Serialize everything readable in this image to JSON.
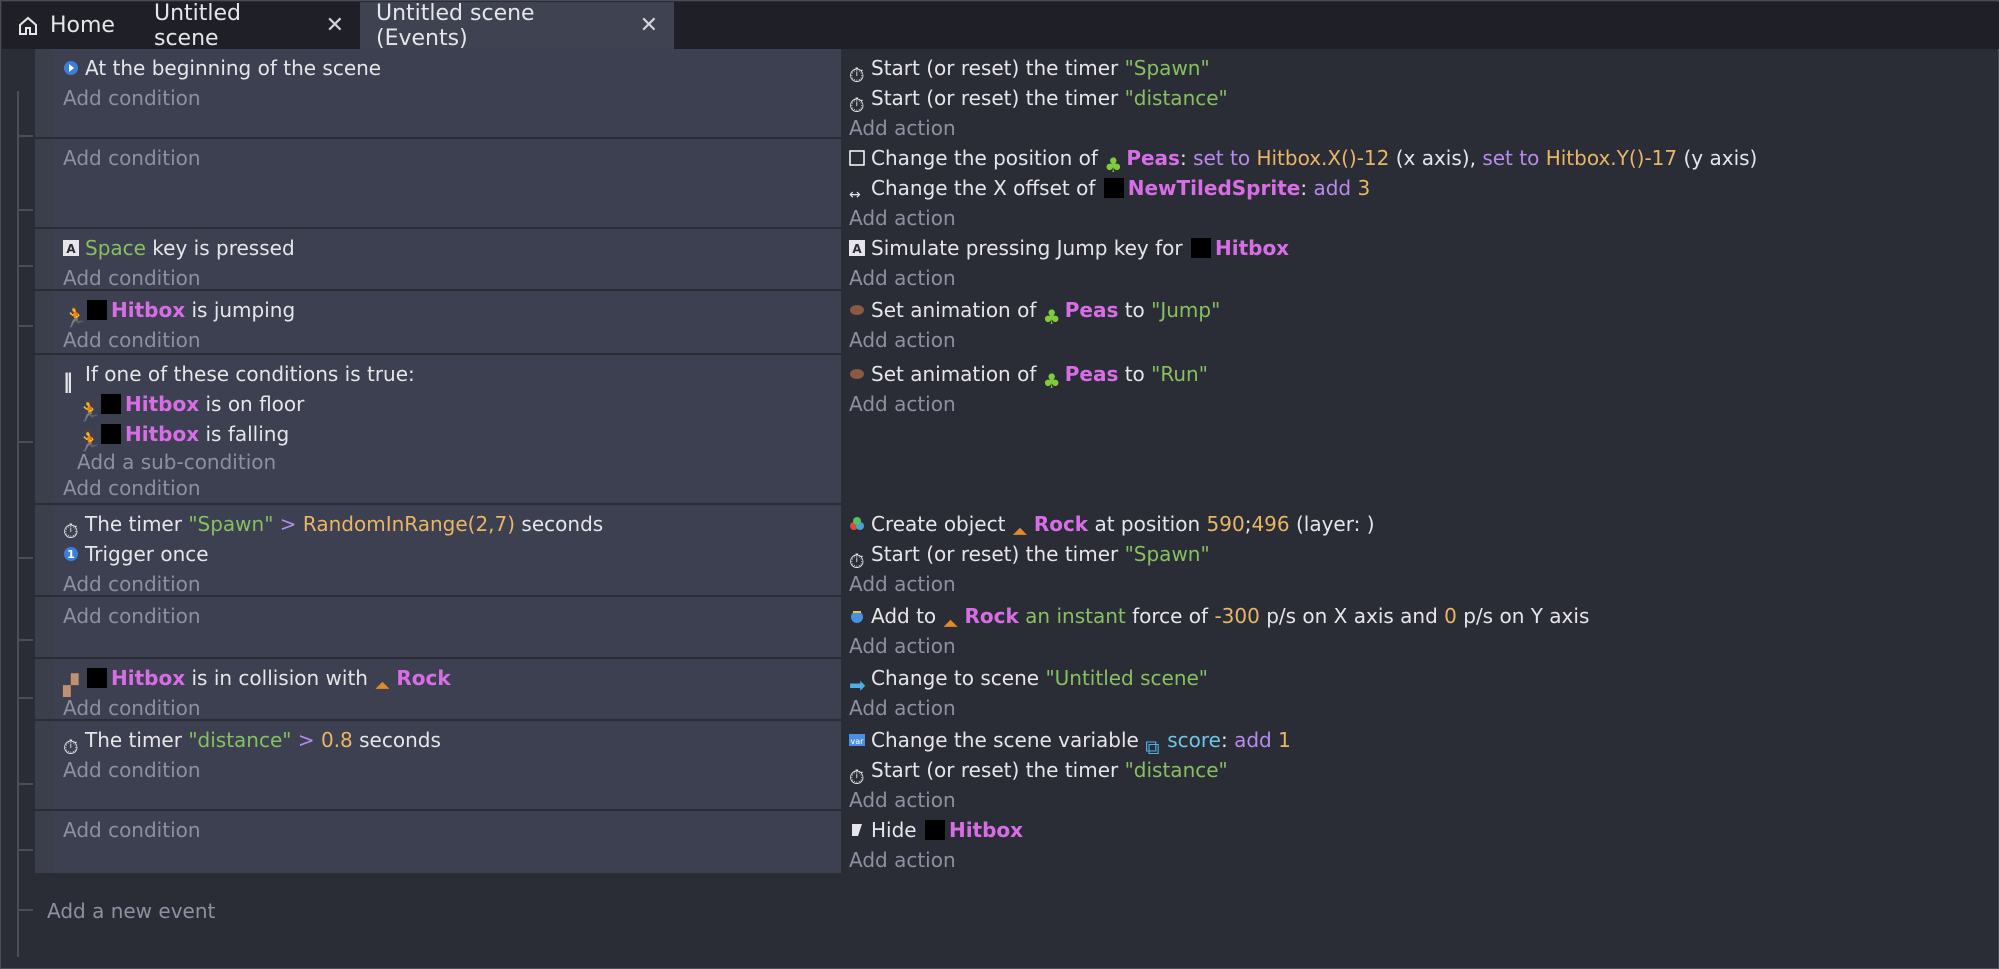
{
  "tabs": [
    {
      "label": "Home",
      "icon": "home-icon"
    },
    {
      "label": "Untitled scene",
      "close": "✕"
    },
    {
      "label": "Untitled scene (Events)",
      "close": "✕"
    }
  ],
  "common": {
    "add_condition": "Add condition",
    "add_action": "Add action",
    "add_sub_condition": "Add a sub-condition",
    "add_new_event": "Add a new event"
  },
  "events": [
    {
      "conditions": [
        {
          "text": "At the beginning of the scene",
          "icon": "scene-start-icon"
        }
      ],
      "actions": [
        {
          "pre": "Start (or reset) the timer ",
          "str": "\"Spawn\"",
          "icon": "timer-icon"
        },
        {
          "pre": "Start (or reset) the timer ",
          "str": "\"distance\"",
          "icon": "timer-icon"
        }
      ]
    },
    {
      "conditions": [],
      "actions": [
        {
          "p1": "Change the position of ",
          "obj": "Peas",
          "p2": ": ",
          "op1": "set to",
          "n1": "Hitbox.X()-12",
          "p3": " (x axis), ",
          "op2": "set to",
          "n2": "Hitbox.Y()-17",
          "p4": " (y axis)",
          "icon": "position-icon"
        },
        {
          "p1": "Change the X offset of ",
          "obj": "NewTiledSprite",
          "p2": ": ",
          "op": "add",
          "n": "3",
          "icon": "offset-icon"
        }
      ]
    },
    {
      "conditions": [
        {
          "key": "Space",
          "rest": " key is pressed",
          "icon": "keyboard-icon"
        }
      ],
      "actions": [
        {
          "pre": "Simulate pressing Jump key for ",
          "obj": "Hitbox",
          "icon": "keyboard-icon"
        }
      ]
    },
    {
      "conditions": [
        {
          "obj": "Hitbox",
          "rest": " is jumping",
          "icon": "platformer-icon"
        }
      ],
      "actions": [
        {
          "pre": "Set animation of ",
          "obj": "Peas",
          "mid": " to ",
          "str": "\"Jump\"",
          "icon": "animation-icon"
        }
      ]
    },
    {
      "conditions": [
        {
          "text": "If one of these conditions is true:",
          "icon": "or-icon"
        },
        {
          "obj": "Hitbox",
          "rest": " is on floor",
          "icon": "platformer-icon"
        },
        {
          "obj": "Hitbox",
          "rest": " is falling",
          "icon": "platformer-icon"
        }
      ],
      "actions": [
        {
          "pre": "Set animation of ",
          "obj": "Peas",
          "mid": " to ",
          "str": "\"Run\"",
          "icon": "animation-icon"
        }
      ]
    },
    {
      "conditions": [
        {
          "pre": "The timer ",
          "str": "\"Spawn\"",
          "op": " > ",
          "num": "RandomInRange(2,7)",
          "post": " seconds",
          "icon": "timer-icon"
        },
        {
          "text": "Trigger once",
          "icon": "trigger-once-icon"
        }
      ],
      "actions": [
        {
          "p1": "Create object ",
          "obj": "Rock",
          "p2": " at position ",
          "n1": "590",
          "sep": ";",
          "n2": "496",
          "p3": " (layer: )",
          "icon": "create-object-icon"
        },
        {
          "pre": "Start (or reset) the timer ",
          "str": "\"Spawn\"",
          "icon": "timer-icon"
        }
      ]
    },
    {
      "conditions": [],
      "actions": [
        {
          "p1": "Add to ",
          "obj": "Rock",
          "kw": " an instant",
          "p2": " force of ",
          "n1": "-300",
          "p3": " p/s on X axis and ",
          "n2": "0",
          "p4": " p/s on Y axis",
          "icon": "force-icon"
        }
      ]
    },
    {
      "conditions": [
        {
          "obj": "Hitbox",
          "mid": " is in collision with ",
          "obj2": "Rock",
          "icon": "collision-icon"
        }
      ],
      "actions": [
        {
          "pre": "Change to scene ",
          "str": "\"Untitled scene\"",
          "icon": "scene-change-icon"
        }
      ]
    },
    {
      "conditions": [
        {
          "pre": "The timer ",
          "str": "\"distance\"",
          "op": " > ",
          "num": "0.8",
          "post": " seconds",
          "icon": "timer-icon"
        }
      ],
      "actions": [
        {
          "pre": "Change the scene variable ",
          "var": "score",
          "p2": ": ",
          "op": "add",
          "n": "1",
          "icon": "variable-icon"
        },
        {
          "pre": "Start (or reset) the timer ",
          "str": "\"distance\"",
          "icon": "timer-icon"
        }
      ]
    },
    {
      "conditions": [],
      "actions": [
        {
          "pre": "Hide ",
          "obj": "Hitbox",
          "icon": "visibility-icon"
        }
      ]
    }
  ],
  "colors": {
    "object": "#d86ee6",
    "string": "#86c060",
    "number": "#e8b664",
    "operator": "#b98aee",
    "variable": "#6cc6e6"
  }
}
